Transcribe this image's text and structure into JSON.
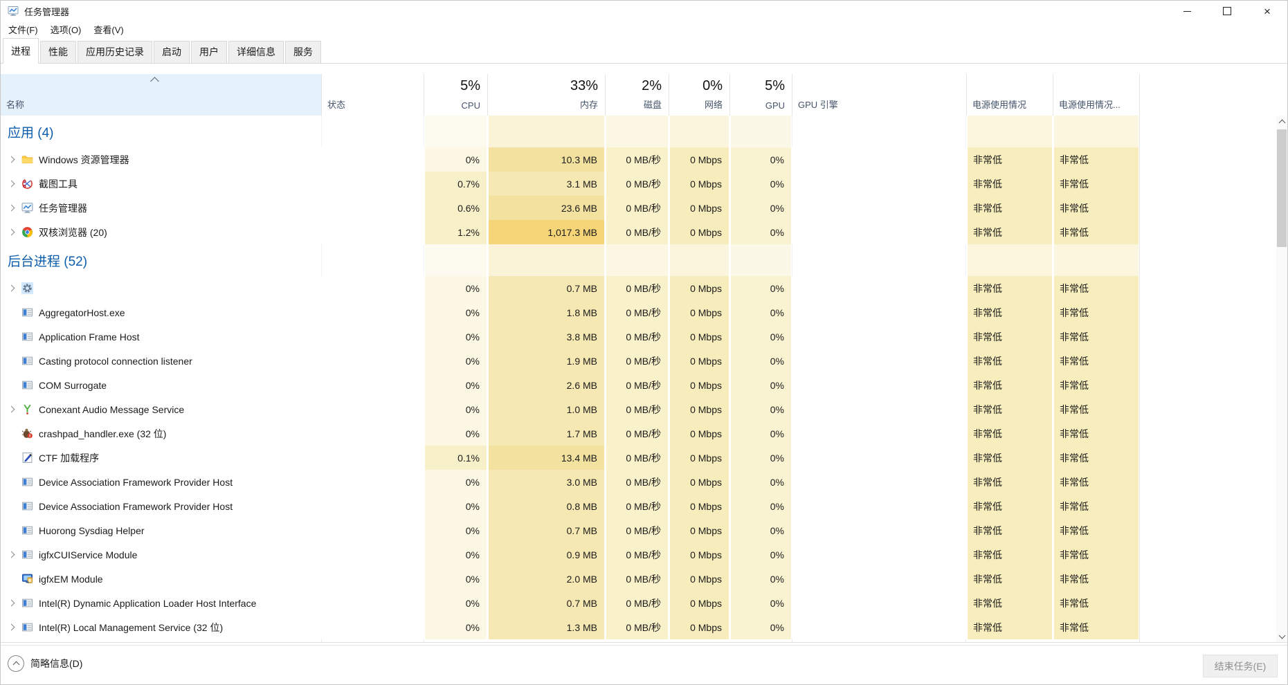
{
  "window": {
    "title": "任务管理器",
    "app_icon": "task-manager-icon",
    "controls": {
      "minimize_icon": "minimize-icon",
      "maximize_icon": "maximize-icon",
      "close_icon": "close-icon",
      "close_glyph": "×"
    }
  },
  "menu": {
    "items": [
      "文件(F)",
      "选项(O)",
      "查看(V)"
    ]
  },
  "tabs": {
    "items": [
      {
        "label": "进程",
        "selected": true
      },
      {
        "label": "性能",
        "selected": false
      },
      {
        "label": "应用历史记录",
        "selected": false
      },
      {
        "label": "启动",
        "selected": false
      },
      {
        "label": "用户",
        "selected": false
      },
      {
        "label": "详细信息",
        "selected": false
      },
      {
        "label": "服务",
        "selected": false
      }
    ]
  },
  "table": {
    "name_header": "名称",
    "sort_icon": "sort-ascending-icon",
    "columns": [
      {
        "key": "status",
        "label": "状态",
        "pct": ""
      },
      {
        "key": "cpu",
        "label": "CPU",
        "pct": "5%"
      },
      {
        "key": "mem",
        "label": "内存",
        "pct": "33%"
      },
      {
        "key": "disk",
        "label": "磁盘",
        "pct": "2%"
      },
      {
        "key": "net",
        "label": "网络",
        "pct": "0%"
      },
      {
        "key": "gpu",
        "label": "GPU",
        "pct": "5%"
      },
      {
        "key": "gpueng",
        "label": "GPU 引擎",
        "pct": ""
      },
      {
        "key": "power",
        "label": "电源使用情况",
        "pct": ""
      },
      {
        "key": "power2",
        "label": "电源使用情况...",
        "pct": ""
      }
    ],
    "groups": [
      {
        "label": "应用 (4)",
        "rows": [
          {
            "icon": "folder-icon",
            "name": "Windows 资源管理器",
            "expandable": true,
            "status": "",
            "cpu": "0%",
            "mem": "10.3 MB",
            "mem_heat": 2,
            "disk": "0 MB/秒",
            "net": "0 Mbps",
            "gpu": "0%",
            "gpueng": "",
            "power": "非常低",
            "power2": "非常低"
          },
          {
            "icon": "snipping-tool-icon",
            "name": "截图工具",
            "expandable": true,
            "status": "",
            "cpu": "0.7%",
            "mem": "3.1 MB",
            "mem_heat": 1,
            "disk": "0 MB/秒",
            "net": "0 Mbps",
            "gpu": "0%",
            "gpueng": "",
            "power": "非常低",
            "power2": "非常低"
          },
          {
            "icon": "task-manager-icon",
            "name": "任务管理器",
            "expandable": true,
            "status": "",
            "cpu": "0.6%",
            "mem": "23.6 MB",
            "mem_heat": 2,
            "disk": "0 MB/秒",
            "net": "0 Mbps",
            "gpu": "0%",
            "gpueng": "",
            "power": "非常低",
            "power2": "非常低"
          },
          {
            "icon": "browser-icon",
            "name": "双核浏览器 (20)",
            "expandable": true,
            "status": "",
            "cpu": "1.2%",
            "mem": "1,017.3 MB",
            "mem_heat": 3,
            "disk": "0 MB/秒",
            "net": "0 Mbps",
            "gpu": "0%",
            "gpueng": "",
            "power": "非常低",
            "power2": "非常低"
          }
        ]
      },
      {
        "label": "后台进程 (52)",
        "rows": [
          {
            "icon": "gear-icon",
            "name": "",
            "expandable": true,
            "status": "",
            "cpu": "0%",
            "mem": "0.7 MB",
            "mem_heat": 1,
            "disk": "0 MB/秒",
            "net": "0 Mbps",
            "gpu": "0%",
            "gpueng": "",
            "power": "非常低",
            "power2": "非常低"
          },
          {
            "icon": "window-icon",
            "name": "AggregatorHost.exe",
            "expandable": false,
            "status": "",
            "cpu": "0%",
            "mem": "1.8 MB",
            "mem_heat": 1,
            "disk": "0 MB/秒",
            "net": "0 Mbps",
            "gpu": "0%",
            "gpueng": "",
            "power": "非常低",
            "power2": "非常低"
          },
          {
            "icon": "window-icon",
            "name": "Application Frame Host",
            "expandable": false,
            "status": "",
            "cpu": "0%",
            "mem": "3.8 MB",
            "mem_heat": 1,
            "disk": "0 MB/秒",
            "net": "0 Mbps",
            "gpu": "0%",
            "gpueng": "",
            "power": "非常低",
            "power2": "非常低"
          },
          {
            "icon": "window-icon",
            "name": "Casting protocol connection listener",
            "expandable": false,
            "status": "",
            "cpu": "0%",
            "mem": "1.9 MB",
            "mem_heat": 1,
            "disk": "0 MB/秒",
            "net": "0 Mbps",
            "gpu": "0%",
            "gpueng": "",
            "power": "非常低",
            "power2": "非常低"
          },
          {
            "icon": "window-icon",
            "name": "COM Surrogate",
            "expandable": false,
            "status": "",
            "cpu": "0%",
            "mem": "2.6 MB",
            "mem_heat": 1,
            "disk": "0 MB/秒",
            "net": "0 Mbps",
            "gpu": "0%",
            "gpueng": "",
            "power": "非常低",
            "power2": "非常低"
          },
          {
            "icon": "conexant-icon",
            "name": "Conexant Audio Message Service",
            "expandable": true,
            "status": "",
            "cpu": "0%",
            "mem": "1.0 MB",
            "mem_heat": 1,
            "disk": "0 MB/秒",
            "net": "0 Mbps",
            "gpu": "0%",
            "gpueng": "",
            "power": "非常低",
            "power2": "非常低"
          },
          {
            "icon": "bug-icon",
            "name": "crashpad_handler.exe (32 位)",
            "expandable": false,
            "status": "",
            "cpu": "0%",
            "mem": "1.7 MB",
            "mem_heat": 1,
            "disk": "0 MB/秒",
            "net": "0 Mbps",
            "gpu": "0%",
            "gpueng": "",
            "power": "非常低",
            "power2": "非常低"
          },
          {
            "icon": "pen-icon",
            "name": "CTF 加载程序",
            "expandable": false,
            "status": "",
            "cpu": "0.1%",
            "mem": "13.4 MB",
            "mem_heat": 2,
            "disk": "0 MB/秒",
            "net": "0 Mbps",
            "gpu": "0%",
            "gpueng": "",
            "power": "非常低",
            "power2": "非常低"
          },
          {
            "icon": "window-icon",
            "name": "Device Association Framework Provider Host",
            "expandable": false,
            "status": "",
            "cpu": "0%",
            "mem": "3.0 MB",
            "mem_heat": 1,
            "disk": "0 MB/秒",
            "net": "0 Mbps",
            "gpu": "0%",
            "gpueng": "",
            "power": "非常低",
            "power2": "非常低"
          },
          {
            "icon": "window-icon",
            "name": "Device Association Framework Provider Host",
            "expandable": false,
            "status": "",
            "cpu": "0%",
            "mem": "0.8 MB",
            "mem_heat": 1,
            "disk": "0 MB/秒",
            "net": "0 Mbps",
            "gpu": "0%",
            "gpueng": "",
            "power": "非常低",
            "power2": "非常低"
          },
          {
            "icon": "window-icon",
            "name": "Huorong Sysdiag Helper",
            "expandable": false,
            "status": "",
            "cpu": "0%",
            "mem": "0.7 MB",
            "mem_heat": 1,
            "disk": "0 MB/秒",
            "net": "0 Mbps",
            "gpu": "0%",
            "gpueng": "",
            "power": "非常低",
            "power2": "非常低"
          },
          {
            "icon": "window-icon",
            "name": "igfxCUIService Module",
            "expandable": true,
            "status": "",
            "cpu": "0%",
            "mem": "0.9 MB",
            "mem_heat": 1,
            "disk": "0 MB/秒",
            "net": "0 Mbps",
            "gpu": "0%",
            "gpueng": "",
            "power": "非常低",
            "power2": "非常低"
          },
          {
            "icon": "igfx-icon",
            "name": "igfxEM Module",
            "expandable": false,
            "status": "",
            "cpu": "0%",
            "mem": "2.0 MB",
            "mem_heat": 1,
            "disk": "0 MB/秒",
            "net": "0 Mbps",
            "gpu": "0%",
            "gpueng": "",
            "power": "非常低",
            "power2": "非常低"
          },
          {
            "icon": "window-icon",
            "name": "Intel(R) Dynamic Application Loader Host Interface",
            "expandable": true,
            "status": "",
            "cpu": "0%",
            "mem": "0.7 MB",
            "mem_heat": 1,
            "disk": "0 MB/秒",
            "net": "0 Mbps",
            "gpu": "0%",
            "gpueng": "",
            "power": "非常低",
            "power2": "非常低"
          },
          {
            "icon": "window-icon",
            "name": "Intel(R) Local Management Service (32 位)",
            "expandable": true,
            "status": "",
            "cpu": "0%",
            "mem": "1.3 MB",
            "mem_heat": 1,
            "disk": "0 MB/秒",
            "net": "0 Mbps",
            "gpu": "0%",
            "gpueng": "",
            "power": "非常低",
            "power2": "非常低"
          }
        ]
      }
    ]
  },
  "scrollbar": {
    "up_icon": "scroll-up-icon",
    "down_icon": "scroll-down-icon"
  },
  "footer": {
    "collapse_icon": "collapse-up-icon",
    "details_label": "简略信息(D)",
    "end_task_label": "结束任务(E)"
  }
}
